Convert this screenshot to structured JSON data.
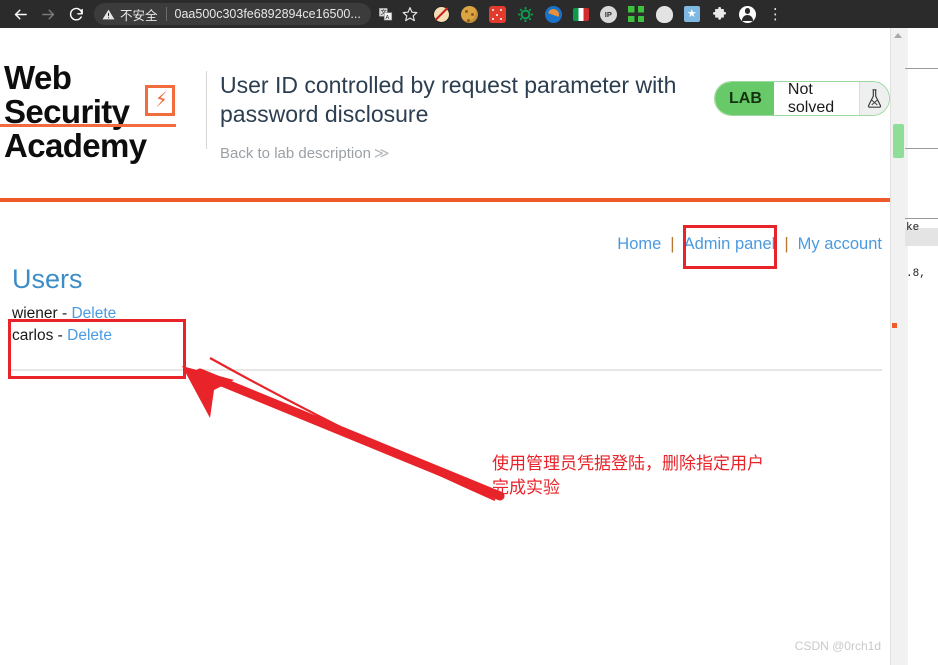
{
  "browser": {
    "back_icon": "back-arrow-icon",
    "forward_icon": "forward-arrow-icon",
    "reload_icon": "reload-icon",
    "security_warning": "不安全",
    "url": "0aa500c303fe6892894ce16500...",
    "translate_icon": "translate-icon",
    "bookmark_icon": "star-icon",
    "menu_icon": "three-dot-menu-icon",
    "extensions": [
      {
        "name": "noscript-extension-icon"
      },
      {
        "name": "cookie-extension-icon"
      },
      {
        "name": "dice-extension-icon"
      },
      {
        "name": "gear-extension-icon"
      },
      {
        "name": "blue-circle-extension-icon"
      },
      {
        "name": "italy-flag-extension-icon"
      },
      {
        "name": "ip-lookup-extension-icon"
      },
      {
        "name": "qr-code-extension-icon"
      },
      {
        "name": "white-shape-extension-icon"
      },
      {
        "name": "star-box-extension-icon"
      },
      {
        "name": "puzzle-extensions-icon"
      },
      {
        "name": "profile-avatar-icon"
      }
    ]
  },
  "lab": {
    "logo_line1": "Web Security",
    "logo_line2": "Academy",
    "logo_bolt": "⚡",
    "title": "User ID controlled by request parameter with password disclosure",
    "back_link": "Back to lab description",
    "back_chevron": "≫",
    "status_tag": "LAB",
    "status_state": "Not solved",
    "status_icon": "flask-icon"
  },
  "site": {
    "nav": [
      {
        "label": "Home"
      },
      {
        "label": "Admin panel"
      },
      {
        "label": "My account"
      }
    ],
    "nav_separator": "|",
    "heading": "Users",
    "users": [
      {
        "name": "wiener",
        "dash": "-",
        "action": "Delete"
      },
      {
        "name": "carlos",
        "dash": "-",
        "action": "Delete"
      }
    ]
  },
  "annotations": {
    "text_line1": "使用管理员凭据登陆，删除指定用户",
    "text_line2": "完成实验",
    "highlight_color": "#e8232a",
    "arrow_icon": "hand-drawn-arrow-icon"
  },
  "background_window": {
    "fragment1": "ke",
    "fragment2": ".8,"
  },
  "watermark": "CSDN @0rch1d",
  "colors": {
    "brand_orange": "#f05a28",
    "link_blue": "#4a9ae0",
    "lab_green": "#68c968",
    "annotation_red": "#e8232a"
  }
}
